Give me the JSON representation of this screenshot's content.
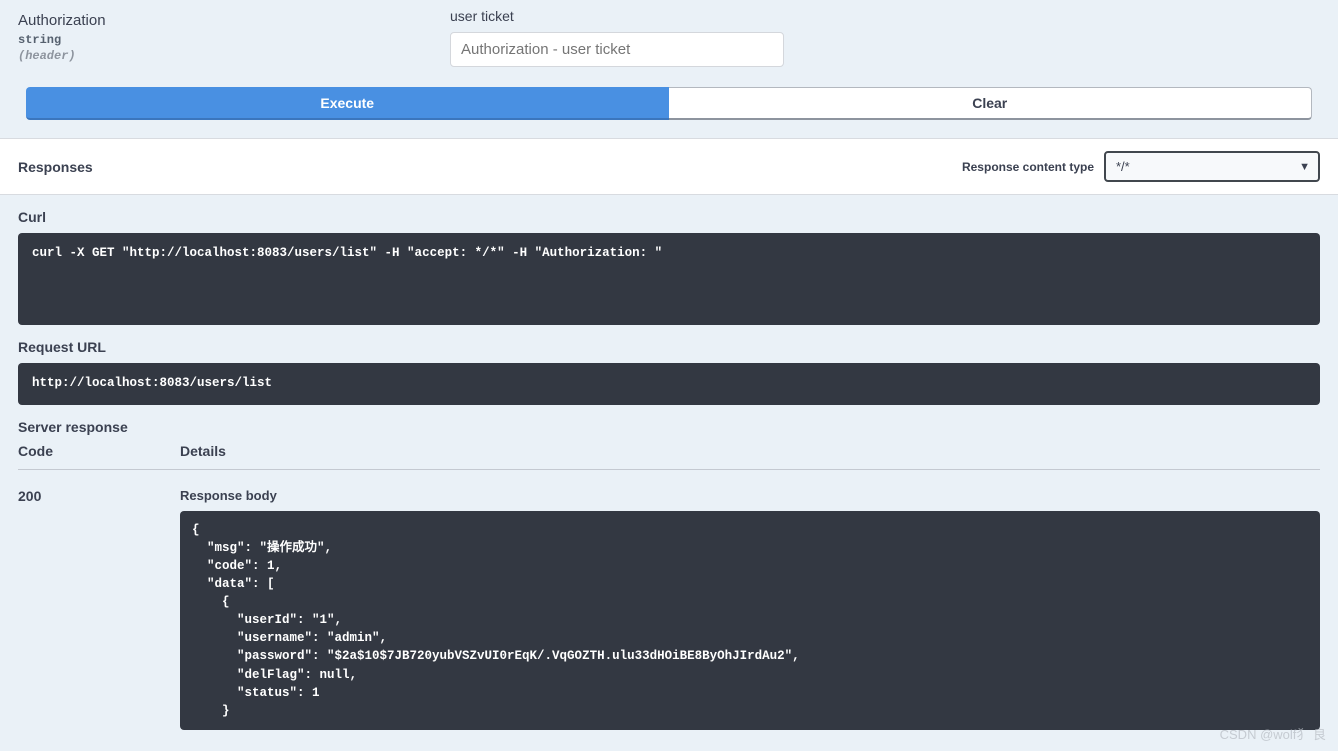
{
  "params": {
    "name": "Authorization",
    "type": "string",
    "in": "(header)",
    "desc": "user ticket",
    "placeholder": "Authorization - user ticket"
  },
  "buttons": {
    "execute": "Execute",
    "clear": "Clear"
  },
  "responses": {
    "title": "Responses",
    "ct_label": "Response content type",
    "ct_value": "*/*"
  },
  "curl": {
    "label": "Curl",
    "command": "curl -X GET \"http://localhost:8083/users/list\" -H \"accept: */*\" -H \"Authorization: \""
  },
  "request_url": {
    "label": "Request URL",
    "value": "http://localhost:8083/users/list"
  },
  "server_response": {
    "label": "Server response",
    "code_header": "Code",
    "details_header": "Details",
    "code": "200",
    "body_label": "Response body",
    "body": "{\n  \"msg\": \"操作成功\",\n  \"code\": 1,\n  \"data\": [\n    {\n      \"userId\": \"1\",\n      \"username\": \"admin\",\n      \"password\": \"$2a$10$7JB720yubVSZvUI0rEqK/.VqGOZTH.ulu33dHOiBE8ByOhJIrdAu2\",\n      \"delFlag\": null,\n      \"status\": 1\n    }"
  },
  "watermark": "CSDN @wolf犭 良"
}
